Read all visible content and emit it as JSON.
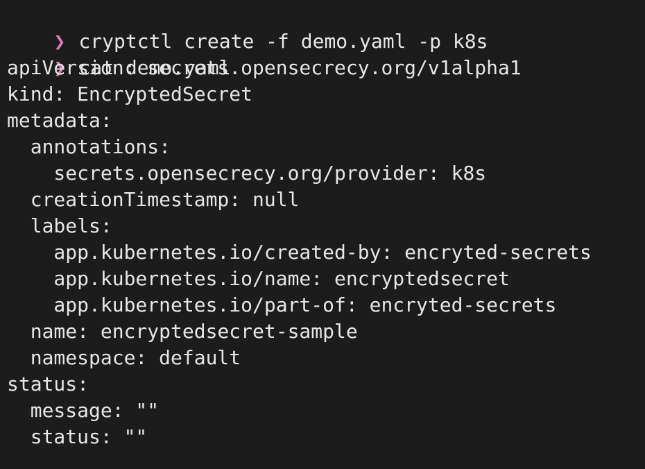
{
  "colors": {
    "background": "#1c1c1c",
    "text": "#e6e6e6",
    "prompt": "#e07ac0"
  },
  "prompt_symbol": "❯",
  "commands": [
    "cryptctl create -f demo.yaml -p k8s",
    "cat demo.yaml"
  ],
  "output_lines": [
    "apiVersion: secrets.opensecrecy.org/v1alpha1",
    "kind: EncryptedSecret",
    "metadata:",
    "  annotations:",
    "    secrets.opensecrecy.org/provider: k8s",
    "  creationTimestamp: null",
    "  labels:",
    "    app.kubernetes.io/created-by: encryted-secrets",
    "    app.kubernetes.io/name: encryptedsecret",
    "    app.kubernetes.io/part-of: encryted-secrets",
    "  name: encryptedsecret-sample",
    "  namespace: default",
    "status:",
    "  message: \"\"",
    "  status: \"\""
  ]
}
